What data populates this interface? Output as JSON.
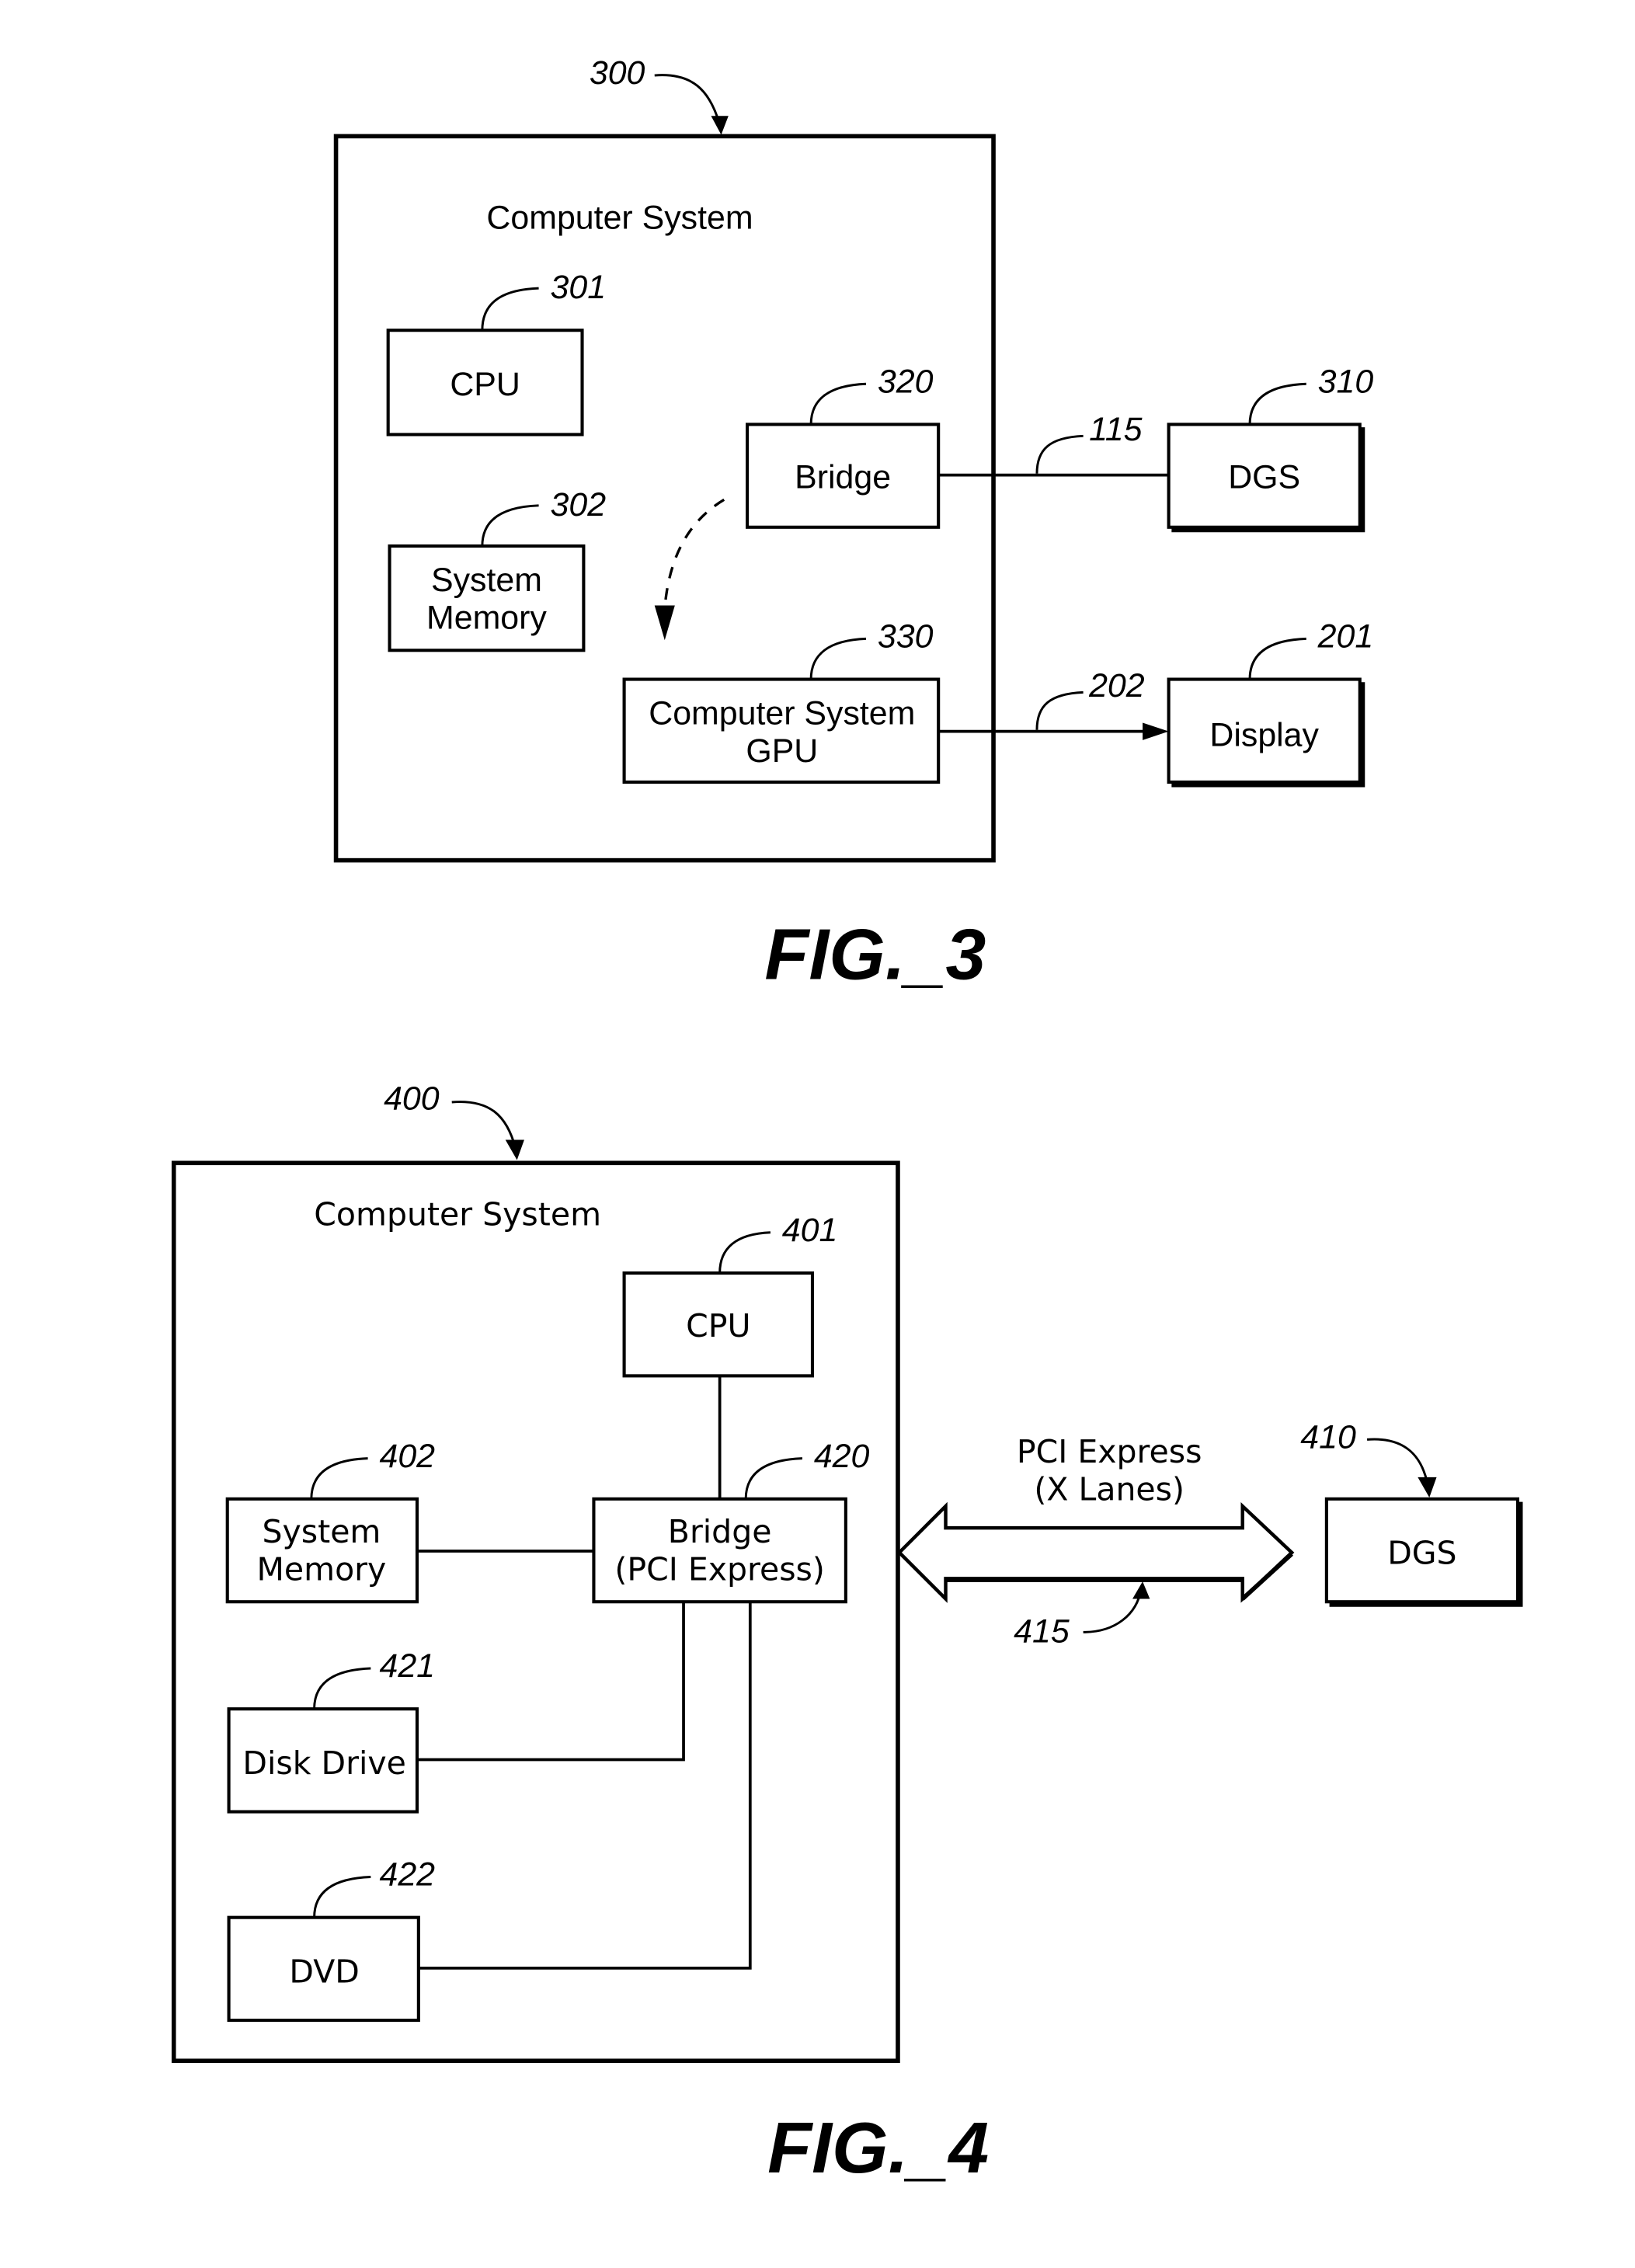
{
  "figures": [
    {
      "id": "fig3",
      "caption": "FIG._3",
      "system": {
        "ref": "300",
        "title": "Computer System"
      },
      "blocks": {
        "cpu": {
          "ref": "301",
          "lines": [
            "CPU"
          ]
        },
        "memory": {
          "ref": "302",
          "lines": [
            "System",
            "Memory"
          ]
        },
        "bridge": {
          "ref": "320",
          "lines": [
            "Bridge"
          ]
        },
        "gpu": {
          "ref": "330",
          "lines": [
            "Computer System",
            "GPU"
          ]
        },
        "dgs": {
          "ref": "310",
          "lines": [
            "DGS"
          ]
        },
        "display": {
          "ref": "201",
          "lines": [
            "Display"
          ]
        }
      },
      "links": {
        "bridge_dgs": {
          "ref": "115"
        },
        "gpu_display": {
          "ref": "202"
        }
      }
    },
    {
      "id": "fig4",
      "caption": "FIG._4",
      "system": {
        "ref": "400",
        "title": "Computer System"
      },
      "blocks": {
        "cpu": {
          "ref": "401",
          "lines": [
            "CPU"
          ]
        },
        "memory": {
          "ref": "402",
          "lines": [
            "System",
            "Memory"
          ]
        },
        "bridge": {
          "ref": "420",
          "lines": [
            "Bridge",
            "(PCI Express)"
          ]
        },
        "disk": {
          "ref": "421",
          "lines": [
            "Disk Drive"
          ]
        },
        "dvd": {
          "ref": "422",
          "lines": [
            "DVD"
          ]
        },
        "dgs": {
          "ref": "410",
          "lines": [
            "DGS"
          ]
        }
      },
      "links": {
        "pcie": {
          "ref": "415",
          "lines": [
            "PCI Express",
            "(X Lanes)"
          ]
        }
      }
    }
  ]
}
